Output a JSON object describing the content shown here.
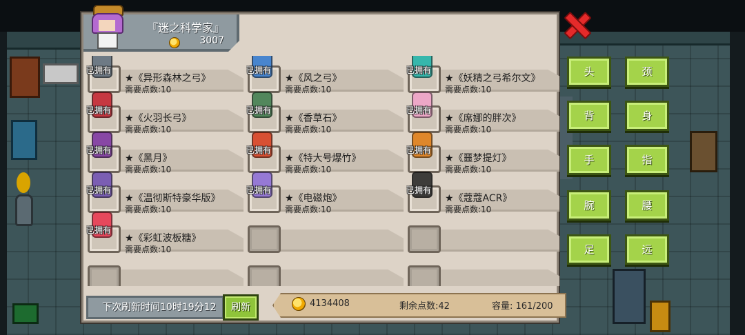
{
  "merchant": {
    "title": "『迷之科学家』",
    "gold": "3007"
  },
  "owned_label": "已拥有",
  "items": [
    {
      "name": "★《异形森林之弓》",
      "cost": "需要点数:10",
      "owned": true,
      "icon": "bow-icon",
      "color": "#5b6b7a"
    },
    {
      "name": "★《风之弓》",
      "cost": "需要点数:10",
      "owned": true,
      "icon": "bow-icon",
      "color": "#2f78d0"
    },
    {
      "name": "★《妖精之弓希尔文》",
      "cost": "需要点数:10",
      "owned": true,
      "icon": "bow-icon",
      "color": "#19b3a8"
    },
    {
      "name": "★《火羽长弓》",
      "cost": "需要点数:10",
      "owned": true,
      "icon": "bow-icon",
      "color": "#c21e2a"
    },
    {
      "name": "★《香草石》",
      "cost": "需要点数:10",
      "owned": true,
      "icon": "stone-icon",
      "color": "#3a7a4a"
    },
    {
      "name": "★《席娜的胖次》",
      "cost": "需要点数:10",
      "owned": true,
      "icon": "cloth-icon",
      "color": "#f0a0c8"
    },
    {
      "name": "★《黑月》",
      "cost": "需要点数:10",
      "owned": true,
      "icon": "box-icon",
      "color": "#7a2fa0"
    },
    {
      "name": "★《特大号爆竹》",
      "cost": "需要点数:10",
      "owned": true,
      "icon": "firecracker-icon",
      "color": "#d83a1a"
    },
    {
      "name": "★《噩梦提灯》",
      "cost": "需要点数:10",
      "owned": true,
      "icon": "lantern-icon",
      "color": "#e07a10"
    },
    {
      "name": "★《温彻斯特豪华版》",
      "cost": "需要点数:10",
      "owned": true,
      "icon": "gun-icon",
      "color": "#6a4ab0"
    },
    {
      "name": "★《电磁炮》",
      "cost": "需要点数:10",
      "owned": true,
      "icon": "gun-icon",
      "color": "#8a6ad8"
    },
    {
      "name": "★《蔻蔻ACR》",
      "cost": "需要点数:10",
      "owned": true,
      "icon": "gun-icon",
      "color": "#222222"
    },
    {
      "name": "★《彩虹波板糖》",
      "cost": "需要点数:10",
      "owned": true,
      "icon": "lollipop-icon",
      "color": "#e8304a"
    },
    {
      "name": "",
      "cost": "",
      "owned": false,
      "icon": "",
      "color": ""
    },
    {
      "name": "",
      "cost": "",
      "owned": false,
      "icon": "",
      "color": ""
    },
    {
      "name": "",
      "cost": "",
      "owned": false,
      "icon": "",
      "color": ""
    },
    {
      "name": "",
      "cost": "",
      "owned": false,
      "icon": "",
      "color": ""
    },
    {
      "name": "",
      "cost": "",
      "owned": false,
      "icon": "",
      "color": ""
    }
  ],
  "footer": {
    "refresh_timer": "下次刷新时间10时19分12",
    "refresh_button": "刷新",
    "gold": "4134408",
    "points": "剩余点数:42",
    "capacity": "容量: 161/200"
  },
  "categories": [
    "头",
    "颈",
    "背",
    "身",
    "手",
    "指",
    "腕",
    "腰",
    "足",
    "远"
  ]
}
